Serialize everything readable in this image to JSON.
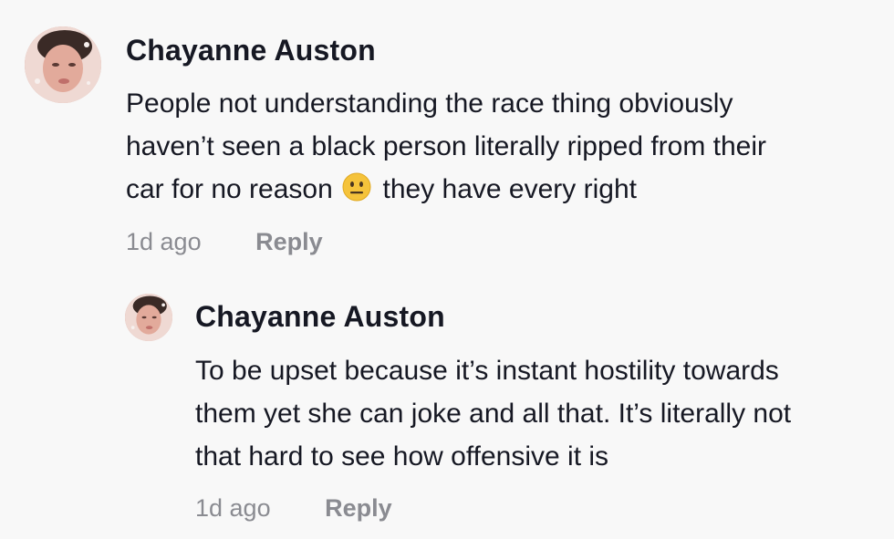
{
  "comment": {
    "username": "Chayanne Auston",
    "text_lines": [
      "People not understanding the race thing obviously",
      "haven’t seen a black person literally ripped from their",
      "car for no reason",
      "they have every right"
    ],
    "emoji_icon": "neutral-face-emoji",
    "time": "1d ago",
    "reply_label": "Reply"
  },
  "reply": {
    "username": "Chayanne Auston",
    "text_lines": [
      "To be upset because it’s instant hostility towards",
      "them yet she can joke and all that. It’s literally not",
      "that hard to see how offensive it is"
    ],
    "time": "1d ago",
    "reply_label": "Reply"
  },
  "colors": {
    "background": "#f8f8f8",
    "text": "#161823",
    "muted": "#8a8b91"
  }
}
